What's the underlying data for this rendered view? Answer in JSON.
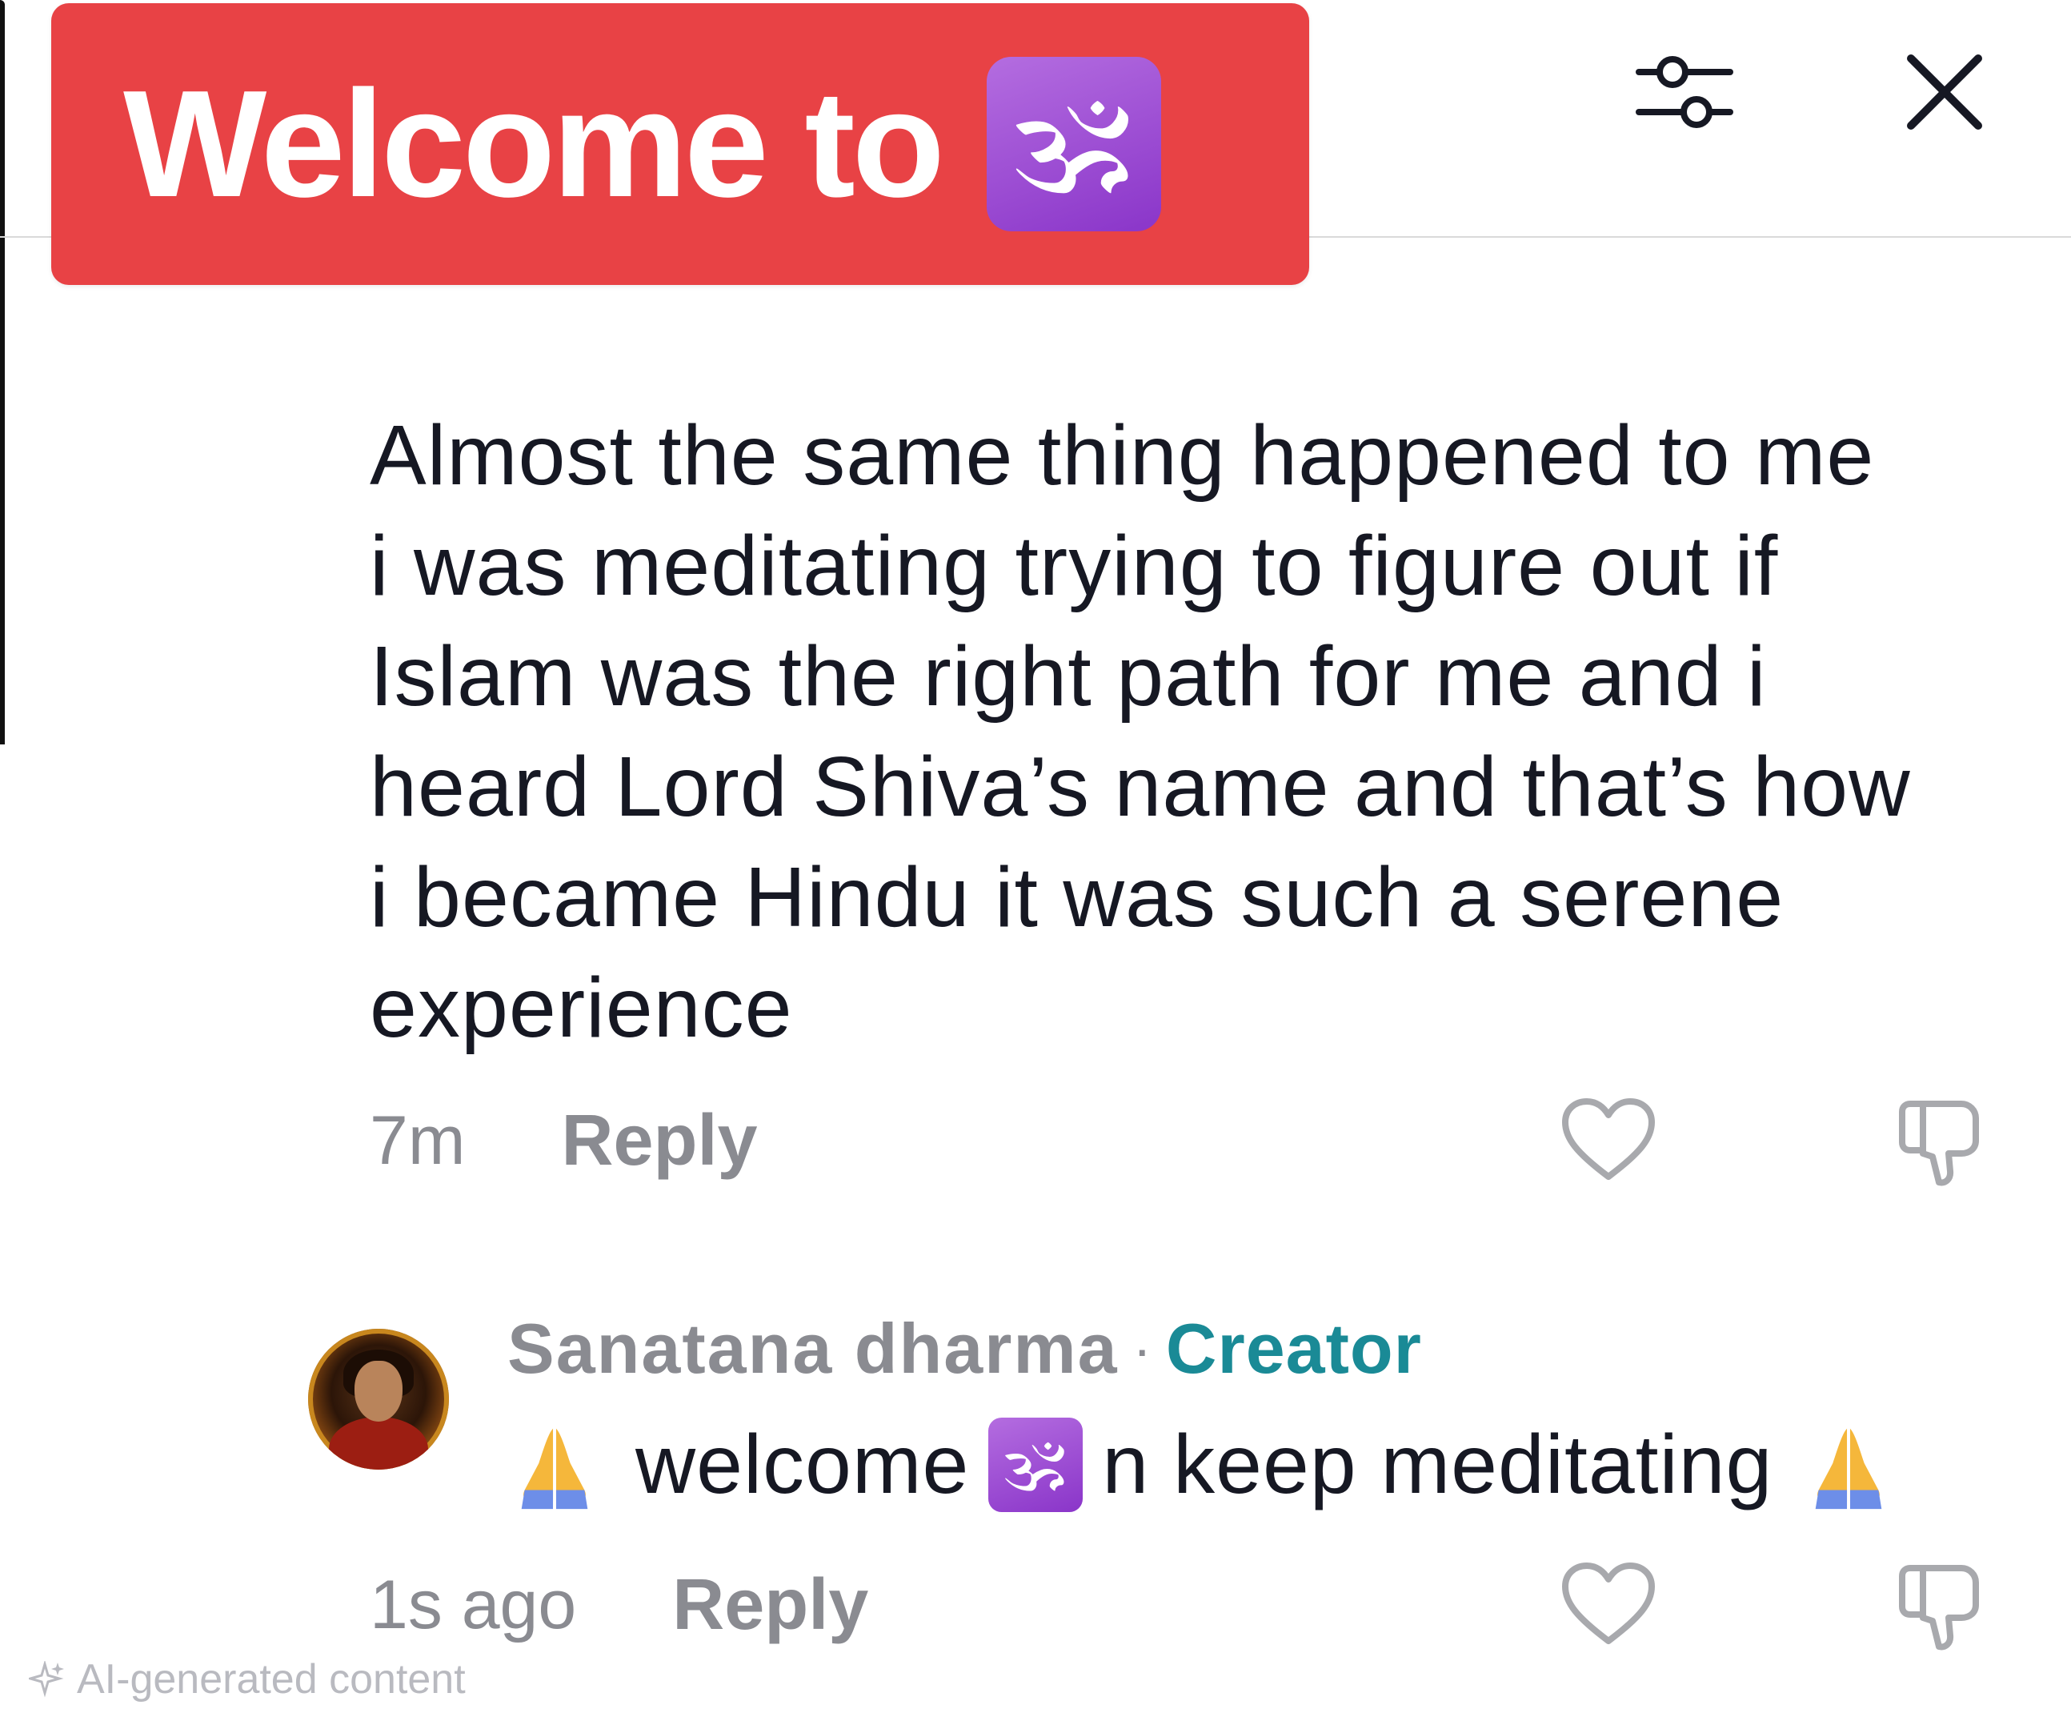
{
  "banner": {
    "text": "Welcome to",
    "emoji": "🕉"
  },
  "header": {
    "filter_icon": "sliders-icon",
    "close_icon": "close-icon"
  },
  "comment": {
    "lines": [
      "Almost the same thing happened to me",
      "i was meditating trying to figure out if",
      "Islam was the right path for me and i",
      "heard Lord Shiva’s name and that’s how",
      "i became Hindu it was such a serene",
      "experience"
    ],
    "time": "7m",
    "reply_label": "Reply"
  },
  "creator_reply": {
    "author": "Sanatana dharma",
    "separator": "·",
    "badge": "Creator",
    "text_before": "welcome",
    "om_emoji": "🕉",
    "text_after": "n keep meditating",
    "time": "1s ago",
    "reply_label": "Reply"
  },
  "footer": {
    "ai_label": "AI-generated content"
  },
  "colors": {
    "banner_bg": "#e84245",
    "creator_accent": "#1a8a96",
    "muted_text": "#8a8b91"
  }
}
